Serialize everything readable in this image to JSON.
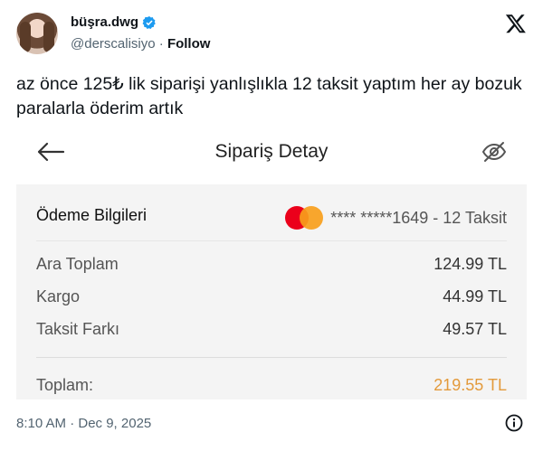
{
  "tweet": {
    "display_name": "büşra.dwg",
    "handle": "@derscalisiyo",
    "separator": "·",
    "follow_label": "Follow",
    "text": "az önce 125₺ lik siparişi yanlışlıkla 12 taksit yaptım her ay bozuk paralarla öderim artık",
    "timestamp": "8:10 AM · Dec 9, 2025"
  },
  "card": {
    "title": "Sipariş Detay",
    "payment": {
      "label": "Ödeme Bilgileri",
      "card_info": "**** *****1649 - 12 Taksit"
    },
    "rows": [
      {
        "label": "Ara Toplam",
        "value": "124.99 TL"
      },
      {
        "label": "Kargo",
        "value": "44.99 TL"
      },
      {
        "label": "Taksit Farkı",
        "value": "49.57 TL"
      }
    ],
    "total": {
      "label": "Toplam:",
      "value": "219.55 TL"
    }
  },
  "colors": {
    "total_accent": "#e39a3b",
    "mastercard_red": "#eb001b",
    "mastercard_orange": "#f79e1b",
    "verified_blue": "#1d9bf0"
  },
  "icons": [
    "x-logo-icon",
    "verified-badge-icon",
    "back-arrow-icon",
    "eye-off-icon",
    "mastercard-icon",
    "info-icon"
  ]
}
